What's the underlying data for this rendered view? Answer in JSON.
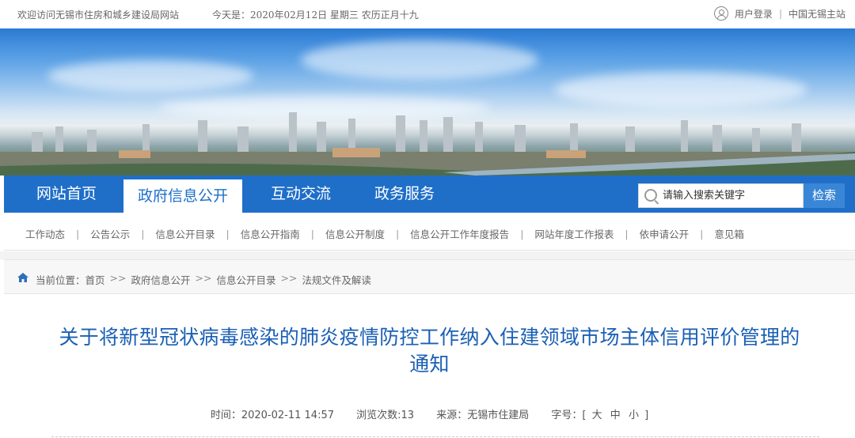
{
  "topbar": {
    "welcome": "欢迎访问无锡市住房和城乡建设局网站",
    "today": "今天是：2020年02月12日  星期三  农历正月十九",
    "login": "用户登录",
    "separator": "|",
    "main_site": "中国无锡主站",
    "user_icon": "user-circle-icon"
  },
  "nav": {
    "items": [
      "网站首页",
      "政府信息公开",
      "互动交流",
      "政务服务"
    ],
    "active_index": 1,
    "search_placeholder": "请输入搜索关键字",
    "search_button": "检索",
    "colors": {
      "nav_bg": "#1f6fc9",
      "search_btn": "#3a86d6"
    }
  },
  "subnav": {
    "links": [
      "工作动态",
      "公告公示",
      "信息公开目录",
      "信息公开指南",
      "信息公开制度",
      "信息公开工作年度报告",
      "网站年度工作报表",
      "依申请公开",
      "意见箱"
    ]
  },
  "breadcrumb": {
    "label": "当前位置：",
    "items": [
      "首页",
      "政府信息公开",
      "信息公开目录",
      "法规文件及解读"
    ],
    "sep": ">>",
    "icon": "home-icon"
  },
  "article": {
    "title_line1": "关于将新型冠状病毒感染的肺炎疫情防控工作纳入住建领域市场主体信用评价管理的",
    "title_line2": "通知",
    "time_label": "时间：",
    "time": "2020-02-11 14:57",
    "views_label": "浏览次数:",
    "views": "13",
    "source_label": "来源：",
    "source": "无锡市住建局",
    "fontsize_label": "字号：",
    "fontsize_open": "[",
    "fontsize_large": "大",
    "fontsize_medium": "中",
    "fontsize_small": "小",
    "fontsize_close": "]",
    "title_color": "#1a5fb4"
  }
}
